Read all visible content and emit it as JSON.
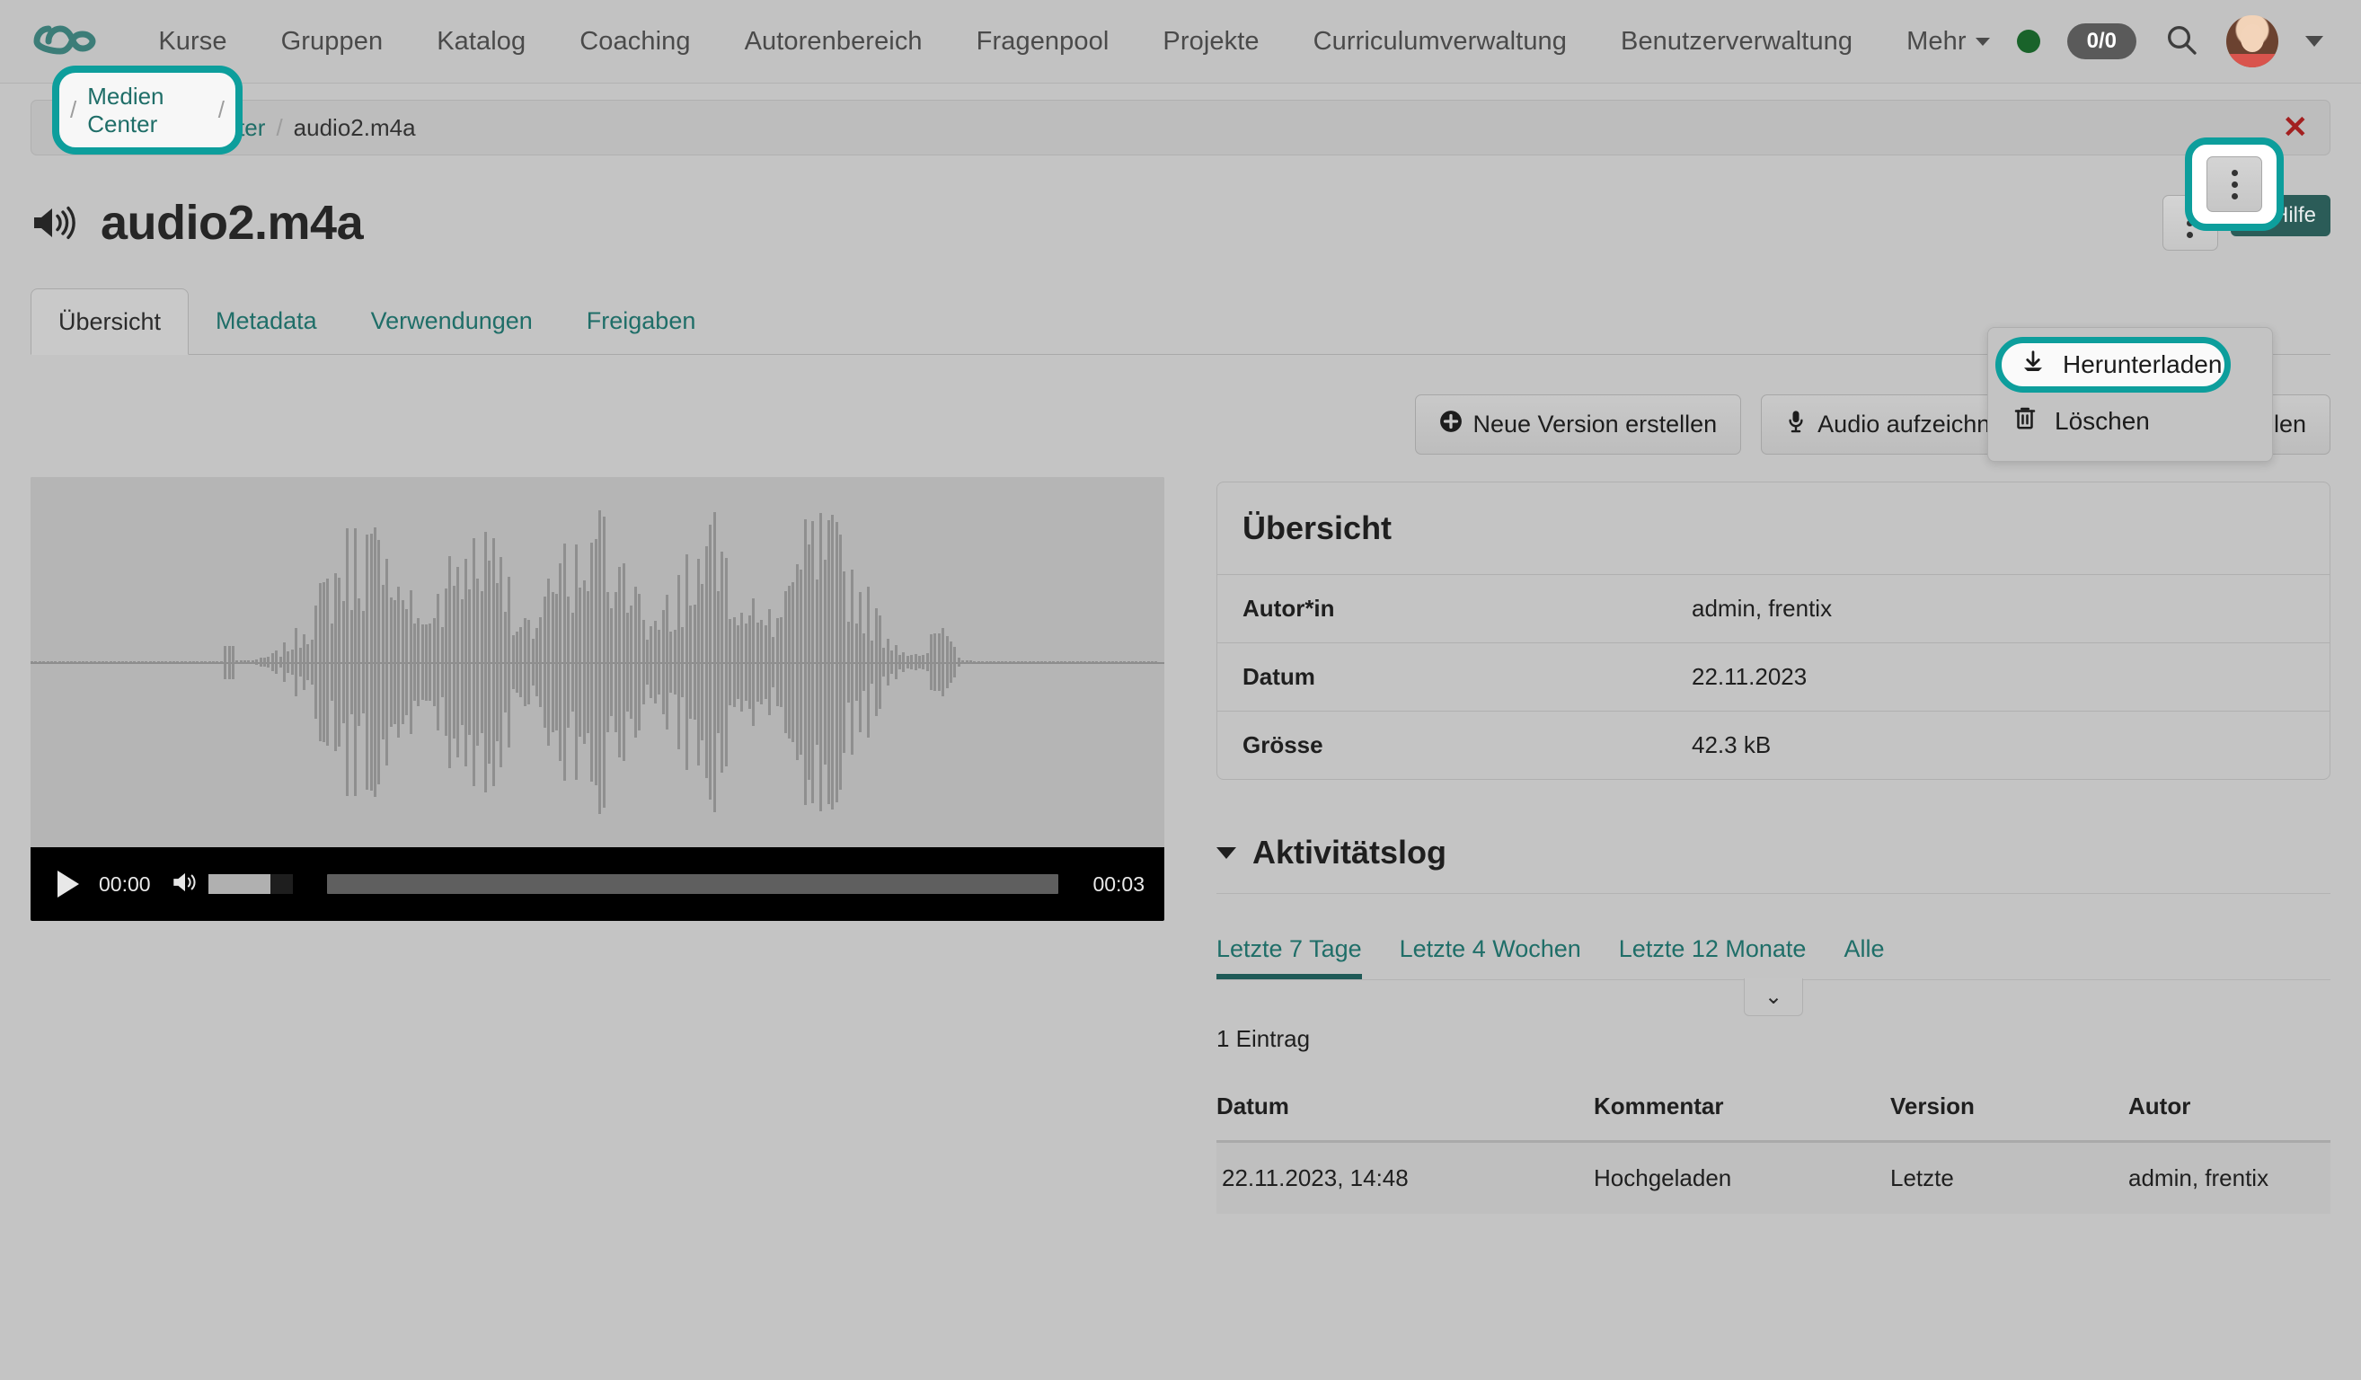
{
  "brand": {
    "logo_icon": "infinity-logo",
    "accent": "#2b7d77",
    "highlight": "#0d9e9c"
  },
  "topnav": {
    "items": [
      {
        "label": "Kurse"
      },
      {
        "label": "Gruppen"
      },
      {
        "label": "Katalog"
      },
      {
        "label": "Coaching"
      },
      {
        "label": "Autorenbereich"
      },
      {
        "label": "Fragenpool"
      },
      {
        "label": "Projekte"
      },
      {
        "label": "Curriculumverwaltung"
      },
      {
        "label": "Benutzerverwaltung"
      },
      {
        "label": "Mehr",
        "has_caret": true
      }
    ],
    "status_dot": "online-status-dot",
    "counter": "0/0",
    "search_icon": "search-icon",
    "avatar": "user-avatar",
    "user_caret": "chevron-down-icon"
  },
  "breadcrumb": {
    "back_icon": "chevron-left-icon",
    "separator": "/",
    "root": "Medien Center",
    "current": "audio2.m4a",
    "close_icon": "close-icon"
  },
  "page": {
    "icon": "speaker-volume-icon",
    "title": "audio2.m4a",
    "kebab_icon": "kebab-menu-icon",
    "help_label": "Hilfe",
    "help_icon": "question-circle-icon"
  },
  "dropdown": {
    "items": [
      {
        "label": "Herunterladen",
        "icon": "download-icon",
        "highlighted": true
      },
      {
        "label": "Löschen",
        "icon": "trash-icon",
        "highlighted": false
      }
    ]
  },
  "tabs": [
    {
      "label": "Übersicht",
      "active": true
    },
    {
      "label": "Metadata",
      "active": false
    },
    {
      "label": "Verwendungen",
      "active": false
    },
    {
      "label": "Freigaben",
      "active": false
    }
  ],
  "actions": [
    {
      "label": "Neue Version erstellen",
      "icon": "plus-circle-icon"
    },
    {
      "label": "Audio aufzeichnen",
      "icon": "microphone-icon"
    },
    {
      "label": "Audio auswählen",
      "icon": "refresh-sync-icon"
    }
  ],
  "player": {
    "play_icon": "play-icon",
    "current_time": "00:00",
    "duration": "00:03",
    "volume_icon": "volume-icon",
    "volume_level": 74,
    "progress_percent": 0
  },
  "overview": {
    "heading": "Übersicht",
    "rows": [
      {
        "key": "Autor*in",
        "value": "admin, frentix"
      },
      {
        "key": "Datum",
        "value": "22.11.2023"
      },
      {
        "key": "Grösse",
        "value": "42.3 kB"
      }
    ]
  },
  "activity": {
    "heading": "Aktivitätslog",
    "toggle_icon": "triangle-down-icon",
    "collapse_icon": "chevron-down-icon",
    "filters": [
      {
        "label": "Letzte 7 Tage",
        "active": true
      },
      {
        "label": "Letzte 4 Wochen",
        "active": false
      },
      {
        "label": "Letzte 12 Monate",
        "active": false
      },
      {
        "label": "Alle",
        "active": false
      }
    ],
    "count_label": "1 Eintrag",
    "columns": [
      "Datum",
      "Kommentar",
      "Version",
      "Autor"
    ],
    "rows": [
      {
        "datum": "22.11.2023, 14:48",
        "kommentar": "Hochgeladen",
        "version": "Letzte",
        "autor": "admin, frentix"
      }
    ]
  }
}
